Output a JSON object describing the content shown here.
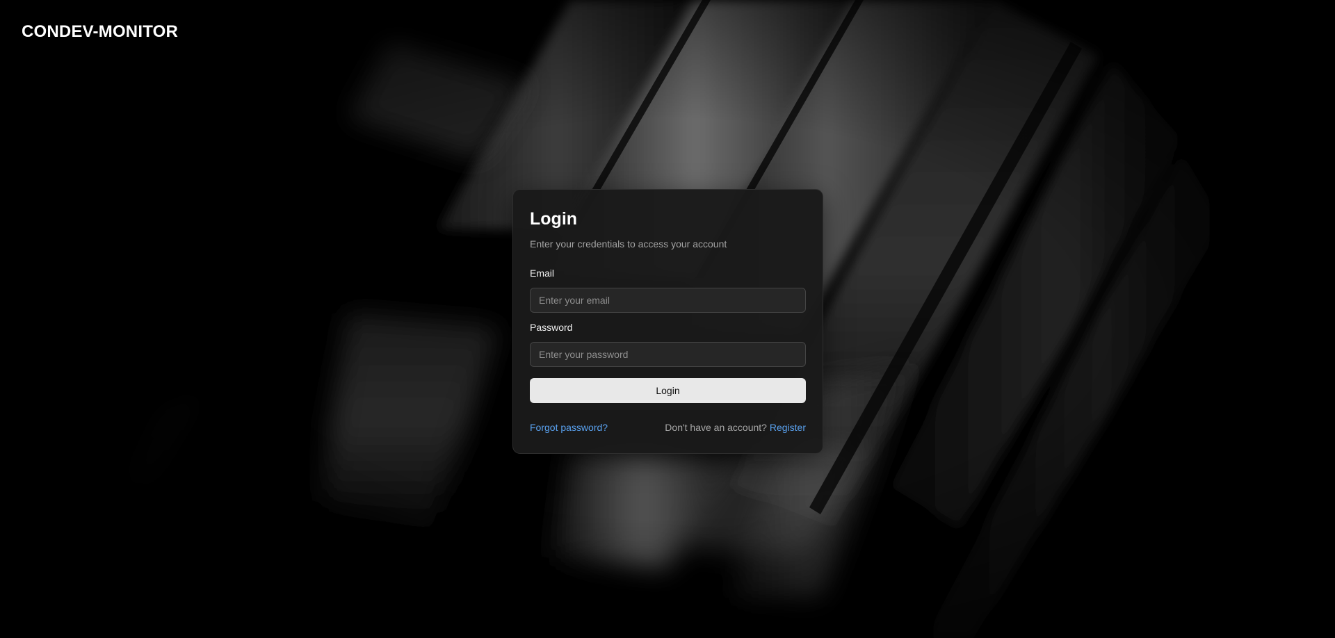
{
  "brand": {
    "title": "CONDEV-MONITOR"
  },
  "login_card": {
    "title": "Login",
    "subtitle": "Enter your credentials to access your account",
    "email": {
      "label": "Email",
      "value": "",
      "placeholder": "Enter your email"
    },
    "password": {
      "label": "Password",
      "value": "",
      "placeholder": "Enter your password"
    },
    "submit_label": "Login",
    "forgot_password_label": "Forgot password?",
    "no_account_text": "Don't have an account?",
    "register_label": "Register"
  },
  "colors": {
    "background": "#000000",
    "card_background": "#1a1a1a",
    "link": "#5aa2f0",
    "button_background": "#e8e8e8",
    "button_text": "#111111"
  }
}
